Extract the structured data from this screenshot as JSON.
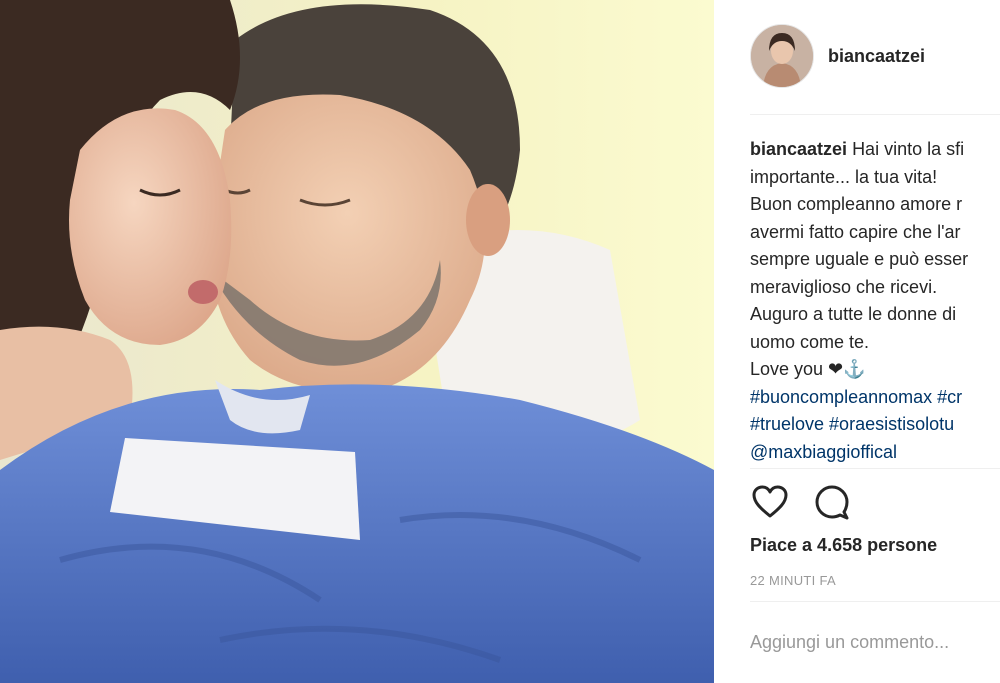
{
  "post": {
    "username": "biancaatzei",
    "caption_lines": [
      "Hai vinto la sfi",
      "importante... la tua vita!",
      "Buon compleanno amore r",
      "avermi fatto capire che l'ar",
      "sempre uguale e può esser",
      "meraviglioso che ricevi.",
      "Auguro a tutte le donne di",
      "uomo come te.",
      "Love you ❤⚓"
    ],
    "hashtags_lines": [
      "#buoncompleannomax #cr",
      "#truelove #oraesistisolotu",
      "@maxbiaggioffical"
    ],
    "likes_text": "Piace a 4.658 persone",
    "time_text": "22 MINUTI FA",
    "comment_placeholder": "Aggiungi un commento..."
  },
  "icons": {
    "like": "heart-icon",
    "comment": "comment-bubble-icon"
  },
  "colors": {
    "text": "#262626",
    "muted": "#999999",
    "hashtag": "#003569",
    "divider": "#efefef"
  }
}
